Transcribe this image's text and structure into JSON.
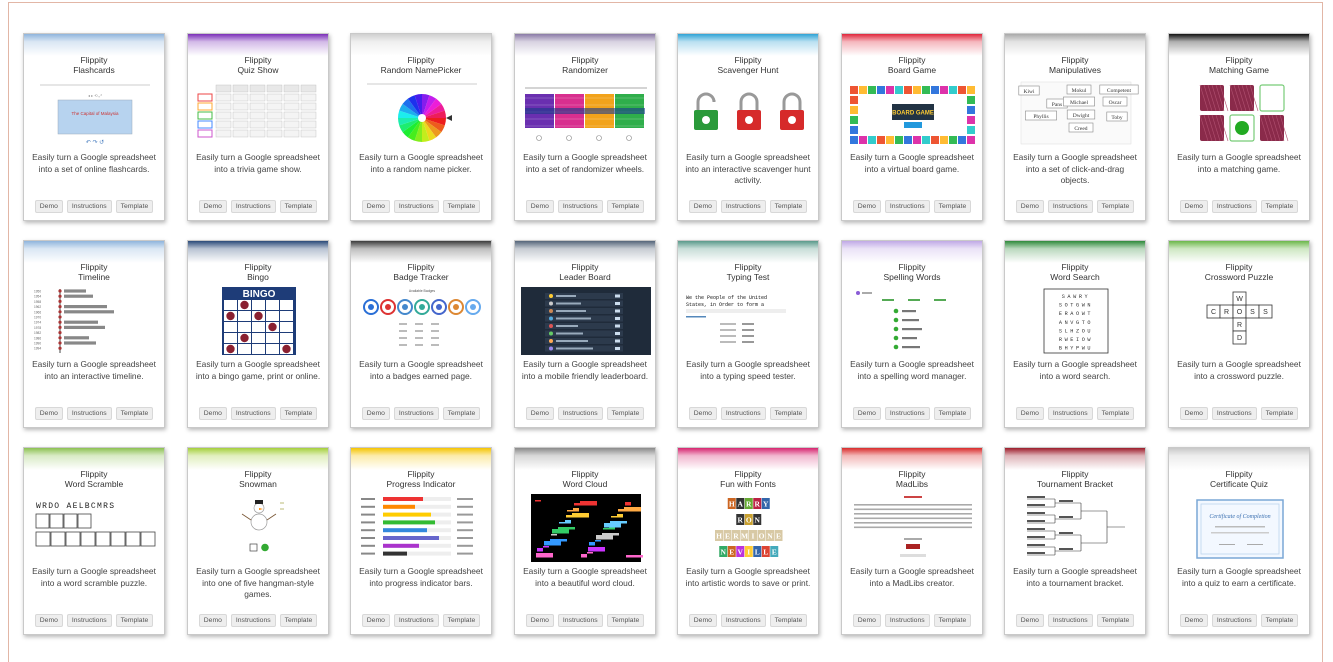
{
  "brand": "Flippity",
  "buttons": {
    "demo": "Demo",
    "instructions": "Instructions",
    "template": "Template"
  },
  "cards": [
    {
      "title": "Flashcards",
      "accent": "#8fb5dd",
      "desc": "Easily turn a Google spreadsheet into a set of online flashcards.",
      "preview_text": "The Capital of Malaysia"
    },
    {
      "title": "Quiz Show",
      "accent": "#7b2fb8",
      "desc": "Easily turn a Google spreadsheet into a trivia game show."
    },
    {
      "title": "Random NamePicker",
      "accent": "#d0d0d0",
      "desc": "Easily turn a Google spreadsheet into a random name picker."
    },
    {
      "title": "Randomizer",
      "accent": "#8a7aa6",
      "desc": "Easily turn a Google spreadsheet into a set of randomizer wheels."
    },
    {
      "title": "Scavenger Hunt",
      "accent": "#2fa3d6",
      "desc": "Easily turn a Google spreadsheet into an interactive scavenger hunt activity."
    },
    {
      "title": "Board Game",
      "accent": "#e0263a",
      "desc": "Easily turn a Google spreadsheet into a virtual board game.",
      "preview_text": "BOARD GAME"
    },
    {
      "title": "Manipulatives",
      "accent": "#a9a9a9",
      "desc": "Easily turn a Google spreadsheet into a set of click-and-drag objects.",
      "words": [
        "Kiwi",
        "Mokul",
        "Competent",
        "Pans",
        "Michael",
        "Oscar",
        "Phyllis",
        "Dwight",
        "Toby",
        "Creed"
      ]
    },
    {
      "title": "Matching Game",
      "accent": "#111111",
      "desc": "Easily turn a Google spreadsheet into a matching game."
    },
    {
      "title": "Timeline",
      "accent": "#8fb5dd",
      "desc": "Easily turn a Google spreadsheet into an interactive timeline."
    },
    {
      "title": "Bingo",
      "accent": "#2b4a78",
      "desc": "Easily turn a Google spreadsheet into a bingo game, print or online.",
      "preview_text": "BINGO"
    },
    {
      "title": "Badge Tracker",
      "accent": "#3c3c3c",
      "desc": "Easily turn a Google spreadsheet into a badges earned page.",
      "preview_text": "Available Badges"
    },
    {
      "title": "Leader Board",
      "accent": "#55657a",
      "desc": "Easily turn a Google spreadsheet into a mobile friendly leaderboard."
    },
    {
      "title": "Typing Test",
      "accent": "#5b9a8b",
      "desc": "Easily turn a Google spreadsheet into a typing speed tester.",
      "preview_text": "We the People of the United States, in Order to form a"
    },
    {
      "title": "Spelling Words",
      "accent": "#c0a9e6",
      "desc": "Easily turn a Google spreadsheet into a spelling word manager."
    },
    {
      "title": "Word Search",
      "accent": "#2f8a3b",
      "desc": "Easily turn a Google spreadsheet into a word search."
    },
    {
      "title": "Crossword Puzzle",
      "accent": "#6cb84a",
      "desc": "Easily turn a Google spreadsheet into a crossword puzzle."
    },
    {
      "title": "Word Scramble",
      "accent": "#8cc152",
      "desc": "Easily turn a Google spreadsheet into a word scramble puzzle.",
      "preview_text": "WRDO AELBCMRS"
    },
    {
      "title": "Snowman",
      "accent": "#a5cf3b",
      "desc": "Easily turn a Google spreadsheet into one of five hangman-style games."
    },
    {
      "title": "Progress Indicator",
      "accent": "#f5c400",
      "desc": "Easily turn a Google spreadsheet into progress indicator bars."
    },
    {
      "title": "Word Cloud",
      "accent": "#8a8a8a",
      "desc": "Easily turn a Google spreadsheet into a beautiful word cloud."
    },
    {
      "title": "Fun with Fonts",
      "accent": "#d6256f",
      "desc": "Easily turn a Google spreadsheet into artistic words to save or print.",
      "words": [
        "HARRY",
        "RON",
        "HERMIONE",
        "NEVILLE"
      ]
    },
    {
      "title": "MadLibs",
      "accent": "#d92b2b",
      "desc": "Easily turn a Google spreadsheet into a MadLibs creator."
    },
    {
      "title": "Tournament Bracket",
      "accent": "#9c1c2a",
      "desc": "Easily turn a Google spreadsheet into a tournament bracket."
    },
    {
      "title": "Certificate Quiz",
      "accent": "#c8c8c8",
      "desc": "Easily turn a Google spreadsheet into a quiz to earn a certificate.",
      "preview_text": "Certificate of Completion"
    }
  ]
}
